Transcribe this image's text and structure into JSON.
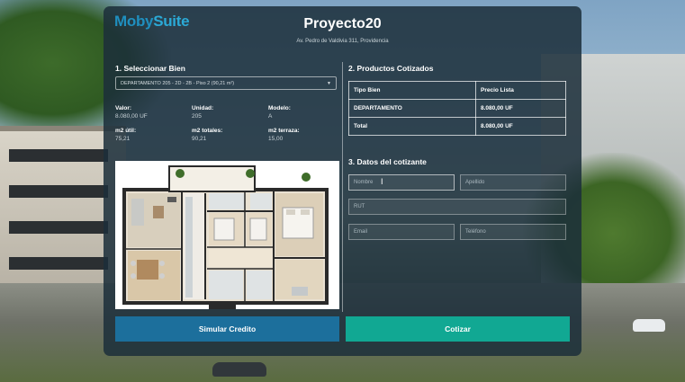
{
  "header": {
    "logo_part1": "Moby",
    "logo_part2": "Suite",
    "title": "Proyecto20",
    "address": "Av. Pedro de Valdivia 311, Providencia"
  },
  "section1": {
    "title": "1. Seleccionar Bien",
    "select_value": "DEPARTAMENTO 205 - 2D - 2B - Piso 2 (90,21 m²)",
    "specs": [
      {
        "label": "Valor:",
        "value": "8.080,00 UF"
      },
      {
        "label": "Unidad:",
        "value": "205"
      },
      {
        "label": "Modelo:",
        "value": "A"
      },
      {
        "label": "m2 útil:",
        "value": "75,21"
      },
      {
        "label": "m2 totales:",
        "value": "90,21"
      },
      {
        "label": "m2 terraza:",
        "value": "15,00"
      }
    ]
  },
  "section2": {
    "title": "2. Productos Cotizados",
    "headers": [
      "Tipo Bien",
      "Precio Lista"
    ],
    "rows": [
      [
        "DEPARTAMENTO",
        "8.080,00 UF"
      ],
      [
        "Total",
        "8.080,00 UF"
      ]
    ]
  },
  "section3": {
    "title": "3. Datos del cotizante",
    "fields": {
      "nombre": "Nombre",
      "apellido": "Apellido",
      "rut": "RUT",
      "email": "Email",
      "telefono": "Teléfono"
    }
  },
  "buttons": {
    "simular": "Simular Credito",
    "cotizar": "Cotizar"
  },
  "colors": {
    "modal_bg": "#1c2f3a",
    "simular_button": "#1c6f9c",
    "cotizar_button": "#11a893",
    "logo": "#1f8fbf"
  }
}
